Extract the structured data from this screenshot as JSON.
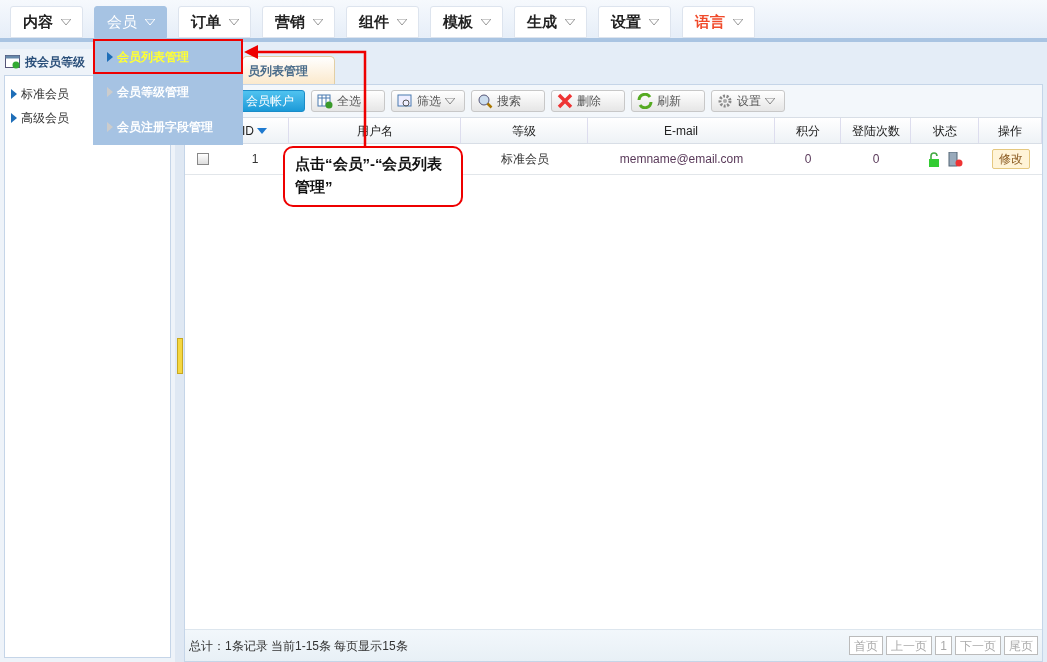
{
  "nav": [
    {
      "label": "内容",
      "selected": false,
      "kind": "normal"
    },
    {
      "label": "会员",
      "selected": true,
      "kind": "normal"
    },
    {
      "label": "订单",
      "selected": false,
      "kind": "normal"
    },
    {
      "label": "营销",
      "selected": false,
      "kind": "normal"
    },
    {
      "label": "组件",
      "selected": false,
      "kind": "normal"
    },
    {
      "label": "模板",
      "selected": false,
      "kind": "normal"
    },
    {
      "label": "生成",
      "selected": false,
      "kind": "normal"
    },
    {
      "label": "设置",
      "selected": false,
      "kind": "normal"
    },
    {
      "label": "语言",
      "selected": false,
      "kind": "language"
    }
  ],
  "dropdown": [
    {
      "label": "会员列表管理",
      "selected": true
    },
    {
      "label": "会员等级管理",
      "selected": false
    },
    {
      "label": "会员注册字段管理",
      "selected": false
    }
  ],
  "sidebar": {
    "title": "按会员等级",
    "items": [
      "标准会员",
      "高级会员"
    ]
  },
  "tab": "员列表管理",
  "toolbar": [
    {
      "label": "会员帐户",
      "kind": "primary"
    },
    {
      "label": "全选",
      "kind": "select-all"
    },
    {
      "label": "筛选",
      "kind": "filter",
      "menu": true
    },
    {
      "label": "搜索",
      "kind": "search"
    },
    {
      "label": "删除",
      "kind": "delete"
    },
    {
      "label": "刷新",
      "kind": "refresh"
    },
    {
      "label": "设置",
      "kind": "settings",
      "menu": true
    }
  ],
  "table": {
    "columns": [
      "ID",
      "用户名",
      "等级",
      "E-mail",
      "积分",
      "登陆次数",
      "状态",
      "操作"
    ],
    "rows": [
      {
        "checked": false,
        "id": "1",
        "level": "标准会员",
        "email": "memname@email.com",
        "points": "0",
        "logins": "0",
        "action": "修改"
      }
    ]
  },
  "footer": {
    "summary": "总计：1条记录 当前1-15条 每页显示15条",
    "pages": [
      "首页",
      "上一页",
      "1",
      "下一页",
      "尾页"
    ]
  },
  "callout": "点击“会员”-“会员列表管理”"
}
